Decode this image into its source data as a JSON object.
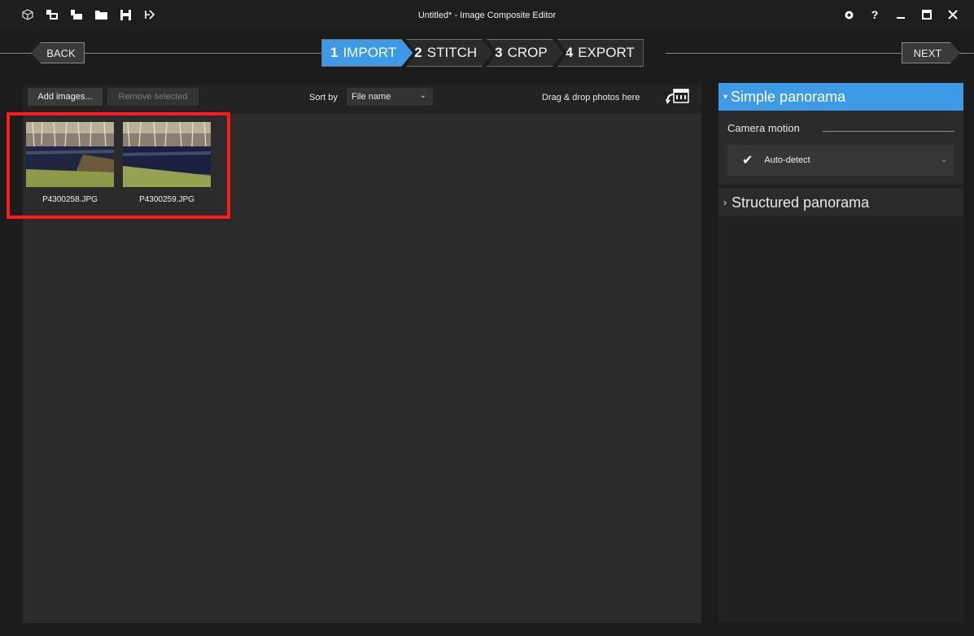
{
  "window": {
    "title": "Untitled* - Image Composite Editor",
    "toolbar_icons": [
      "new-project-icon",
      "import-images-icon",
      "import-video-icon",
      "open-folder-icon",
      "save-icon",
      "publish-icon"
    ],
    "controls": [
      "settings-icon",
      "help-icon",
      "minimize-icon",
      "maximize-icon",
      "close-icon"
    ]
  },
  "wizard": {
    "back_label": "BACK",
    "next_label": "NEXT",
    "steps": [
      {
        "num": "1",
        "label": "IMPORT",
        "active": true
      },
      {
        "num": "2",
        "label": "STITCH",
        "active": false
      },
      {
        "num": "3",
        "label": "CROP",
        "active": false
      },
      {
        "num": "4",
        "label": "EXPORT",
        "active": false
      }
    ]
  },
  "import": {
    "add_label": "Add images...",
    "remove_label": "Remove selected",
    "sort_label": "Sort by",
    "sort_value": "File name",
    "drag_label": "Drag & drop photos here",
    "images": [
      {
        "name": "P4300258.JPG"
      },
      {
        "name": "P4300259.JPG"
      }
    ]
  },
  "panorama": {
    "simple_label": "Simple panorama",
    "camera_motion_label": "Camera motion",
    "camera_motion_value": "Auto-detect",
    "structured_label": "Structured panorama"
  },
  "colors": {
    "accent": "#3c9ae6",
    "highlight": "#ff1a1a",
    "background": "#1c1c1c"
  }
}
